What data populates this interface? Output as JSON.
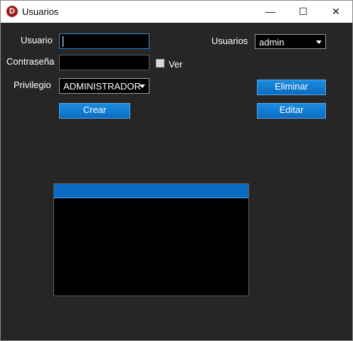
{
  "window": {
    "title": "Usuarios",
    "app_icon_letter": "D",
    "controls": {
      "minimize": "—",
      "maximize": "☐",
      "close": "✕"
    }
  },
  "form": {
    "usuario_label": "Usuario",
    "usuario_value": "",
    "contrasena_label": "Contraseña",
    "contrasena_value": "",
    "ver_label": "Ver",
    "ver_checked": false,
    "privilegio_label": "Privilegio",
    "privilegio_value": "ADMINISTRADOR",
    "usuarios_label": "Usuarios",
    "usuarios_value": "admin"
  },
  "buttons": {
    "crear": "Crear",
    "eliminar": "Eliminar",
    "editar": "Editar"
  },
  "list": {
    "items": []
  },
  "colors": {
    "background": "#262626",
    "accent": "#0a6bc2"
  }
}
